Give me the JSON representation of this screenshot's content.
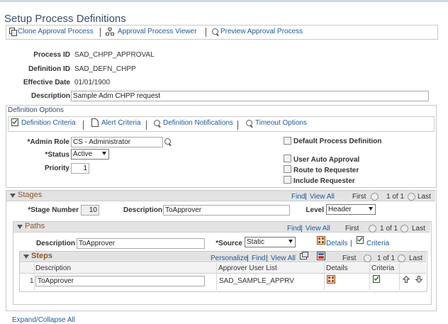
{
  "page": {
    "title": "Setup Process Definitions"
  },
  "toolbar": {
    "clone": "Clone Approval Process",
    "viewer": "Approval Process Viewer",
    "preview": "Preview Approval Process"
  },
  "header": {
    "process_id_label": "Process ID",
    "process_id": "SAD_CHPP_APPROVAL",
    "definition_id_label": "Definition ID",
    "definition_id": "SAD_DEFN_CHPP",
    "effective_date_label": "Effective Date",
    "effective_date": "01/01/1900",
    "description_label": "Description",
    "description": "Sample Adm CHPP request"
  },
  "definition_options": {
    "title": "Definition Options",
    "links": {
      "criteria": "Definition Criteria",
      "alert": "Alert Criteria",
      "notifications": "Definition Notifications",
      "timeout": "Timeout Options"
    },
    "admin_role_label": "*Admin Role",
    "admin_role": "CS - Administrator",
    "status_label": "*Status",
    "status": "Active",
    "priority_label": "Priority",
    "priority": "1",
    "checkboxes": {
      "default_process": "Default Process Definition",
      "user_auto_approval": "User Auto Approval",
      "route_to_requester": "Route to Requester",
      "include_requester": "Include Requester"
    }
  },
  "stages": {
    "title": "Stages",
    "nav_find": "Find",
    "nav_view_all": "View All",
    "nav_first": "First",
    "nav_count": "1 of 1",
    "nav_last": "Last",
    "stage_number_label": "*Stage Number",
    "stage_number": "10",
    "description_label": "Description",
    "description": "ToApprover",
    "level_label": "Level",
    "level": "Header"
  },
  "paths": {
    "title": "Paths",
    "nav_find": "Find",
    "nav_view_all": "View All",
    "nav_first": "First",
    "nav_count": "1 of 1",
    "nav_last": "Last",
    "description_label": "Description",
    "description": "ToApprover",
    "source_label": "*Source",
    "source": "Static",
    "details": "Details",
    "criteria": "Criteria"
  },
  "steps": {
    "title": "Steps",
    "personalize": "Personalize",
    "nav_find": "Find",
    "nav_view_all": "View All",
    "nav_first": "First",
    "nav_count": "1 of 1",
    "nav_last": "Last",
    "columns": {
      "description": "Description",
      "approver": "Approver User List",
      "details": "Details",
      "criteria": "Criteria"
    },
    "rows": [
      {
        "num": "1",
        "description": "ToApprover",
        "approver": "SAD_SAMPLE_APPRV"
      }
    ]
  },
  "footer": {
    "expand_collapse": "Expand/Collapse All"
  }
}
